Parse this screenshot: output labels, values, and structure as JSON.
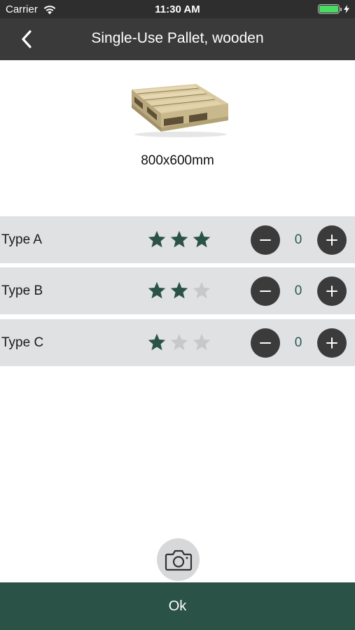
{
  "status_bar": {
    "carrier": "Carrier",
    "time": "11:30 AM",
    "battery_level": 1.0
  },
  "nav": {
    "title": "Single-Use Pallet, wooden",
    "back_icon": "chevron-left-icon"
  },
  "product": {
    "image_icon": "wooden-pallet-image",
    "size": "800x600mm"
  },
  "types": [
    {
      "label": "Type A",
      "rating": 3,
      "max_rating": 3,
      "quantity": "0"
    },
    {
      "label": "Type B",
      "rating": 2,
      "max_rating": 3,
      "quantity": "0"
    },
    {
      "label": "Type C",
      "rating": 1,
      "max_rating": 3,
      "quantity": "0"
    }
  ],
  "camera": {
    "icon": "camera-icon"
  },
  "ok_label": "Ok",
  "colors": {
    "nav_background": "#3a3a3a",
    "row_background": "#e0e1e3",
    "star_filled": "#2b5246",
    "star_empty": "#c7c8ca",
    "ok_background": "#2b5246",
    "stepper_button": "#3b3b3b",
    "quantity_text": "#2a5a4e",
    "battery": "#4cd964"
  }
}
